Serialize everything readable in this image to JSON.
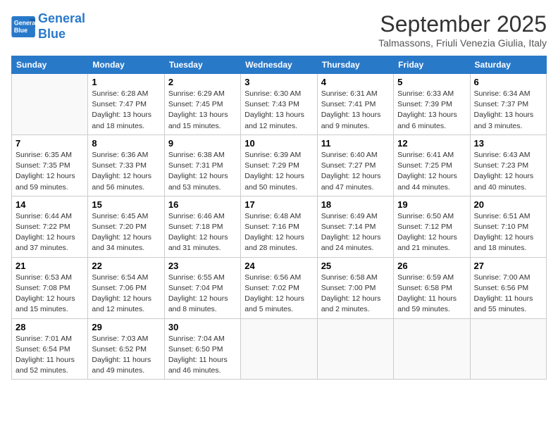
{
  "header": {
    "logo_line1": "General",
    "logo_line2": "Blue",
    "month": "September 2025",
    "location": "Talmassons, Friuli Venezia Giulia, Italy"
  },
  "days_of_week": [
    "Sunday",
    "Monday",
    "Tuesday",
    "Wednesday",
    "Thursday",
    "Friday",
    "Saturday"
  ],
  "weeks": [
    [
      {
        "day": "",
        "info": ""
      },
      {
        "day": "1",
        "info": "Sunrise: 6:28 AM\nSunset: 7:47 PM\nDaylight: 13 hours\nand 18 minutes."
      },
      {
        "day": "2",
        "info": "Sunrise: 6:29 AM\nSunset: 7:45 PM\nDaylight: 13 hours\nand 15 minutes."
      },
      {
        "day": "3",
        "info": "Sunrise: 6:30 AM\nSunset: 7:43 PM\nDaylight: 13 hours\nand 12 minutes."
      },
      {
        "day": "4",
        "info": "Sunrise: 6:31 AM\nSunset: 7:41 PM\nDaylight: 13 hours\nand 9 minutes."
      },
      {
        "day": "5",
        "info": "Sunrise: 6:33 AM\nSunset: 7:39 PM\nDaylight: 13 hours\nand 6 minutes."
      },
      {
        "day": "6",
        "info": "Sunrise: 6:34 AM\nSunset: 7:37 PM\nDaylight: 13 hours\nand 3 minutes."
      }
    ],
    [
      {
        "day": "7",
        "info": "Sunrise: 6:35 AM\nSunset: 7:35 PM\nDaylight: 12 hours\nand 59 minutes."
      },
      {
        "day": "8",
        "info": "Sunrise: 6:36 AM\nSunset: 7:33 PM\nDaylight: 12 hours\nand 56 minutes."
      },
      {
        "day": "9",
        "info": "Sunrise: 6:38 AM\nSunset: 7:31 PM\nDaylight: 12 hours\nand 53 minutes."
      },
      {
        "day": "10",
        "info": "Sunrise: 6:39 AM\nSunset: 7:29 PM\nDaylight: 12 hours\nand 50 minutes."
      },
      {
        "day": "11",
        "info": "Sunrise: 6:40 AM\nSunset: 7:27 PM\nDaylight: 12 hours\nand 47 minutes."
      },
      {
        "day": "12",
        "info": "Sunrise: 6:41 AM\nSunset: 7:25 PM\nDaylight: 12 hours\nand 44 minutes."
      },
      {
        "day": "13",
        "info": "Sunrise: 6:43 AM\nSunset: 7:23 PM\nDaylight: 12 hours\nand 40 minutes."
      }
    ],
    [
      {
        "day": "14",
        "info": "Sunrise: 6:44 AM\nSunset: 7:22 PM\nDaylight: 12 hours\nand 37 minutes."
      },
      {
        "day": "15",
        "info": "Sunrise: 6:45 AM\nSunset: 7:20 PM\nDaylight: 12 hours\nand 34 minutes."
      },
      {
        "day": "16",
        "info": "Sunrise: 6:46 AM\nSunset: 7:18 PM\nDaylight: 12 hours\nand 31 minutes."
      },
      {
        "day": "17",
        "info": "Sunrise: 6:48 AM\nSunset: 7:16 PM\nDaylight: 12 hours\nand 28 minutes."
      },
      {
        "day": "18",
        "info": "Sunrise: 6:49 AM\nSunset: 7:14 PM\nDaylight: 12 hours\nand 24 minutes."
      },
      {
        "day": "19",
        "info": "Sunrise: 6:50 AM\nSunset: 7:12 PM\nDaylight: 12 hours\nand 21 minutes."
      },
      {
        "day": "20",
        "info": "Sunrise: 6:51 AM\nSunset: 7:10 PM\nDaylight: 12 hours\nand 18 minutes."
      }
    ],
    [
      {
        "day": "21",
        "info": "Sunrise: 6:53 AM\nSunset: 7:08 PM\nDaylight: 12 hours\nand 15 minutes."
      },
      {
        "day": "22",
        "info": "Sunrise: 6:54 AM\nSunset: 7:06 PM\nDaylight: 12 hours\nand 12 minutes."
      },
      {
        "day": "23",
        "info": "Sunrise: 6:55 AM\nSunset: 7:04 PM\nDaylight: 12 hours\nand 8 minutes."
      },
      {
        "day": "24",
        "info": "Sunrise: 6:56 AM\nSunset: 7:02 PM\nDaylight: 12 hours\nand 5 minutes."
      },
      {
        "day": "25",
        "info": "Sunrise: 6:58 AM\nSunset: 7:00 PM\nDaylight: 12 hours\nand 2 minutes."
      },
      {
        "day": "26",
        "info": "Sunrise: 6:59 AM\nSunset: 6:58 PM\nDaylight: 11 hours\nand 59 minutes."
      },
      {
        "day": "27",
        "info": "Sunrise: 7:00 AM\nSunset: 6:56 PM\nDaylight: 11 hours\nand 55 minutes."
      }
    ],
    [
      {
        "day": "28",
        "info": "Sunrise: 7:01 AM\nSunset: 6:54 PM\nDaylight: 11 hours\nand 52 minutes."
      },
      {
        "day": "29",
        "info": "Sunrise: 7:03 AM\nSunset: 6:52 PM\nDaylight: 11 hours\nand 49 minutes."
      },
      {
        "day": "30",
        "info": "Sunrise: 7:04 AM\nSunset: 6:50 PM\nDaylight: 11 hours\nand 46 minutes."
      },
      {
        "day": "",
        "info": ""
      },
      {
        "day": "",
        "info": ""
      },
      {
        "day": "",
        "info": ""
      },
      {
        "day": "",
        "info": ""
      }
    ]
  ]
}
